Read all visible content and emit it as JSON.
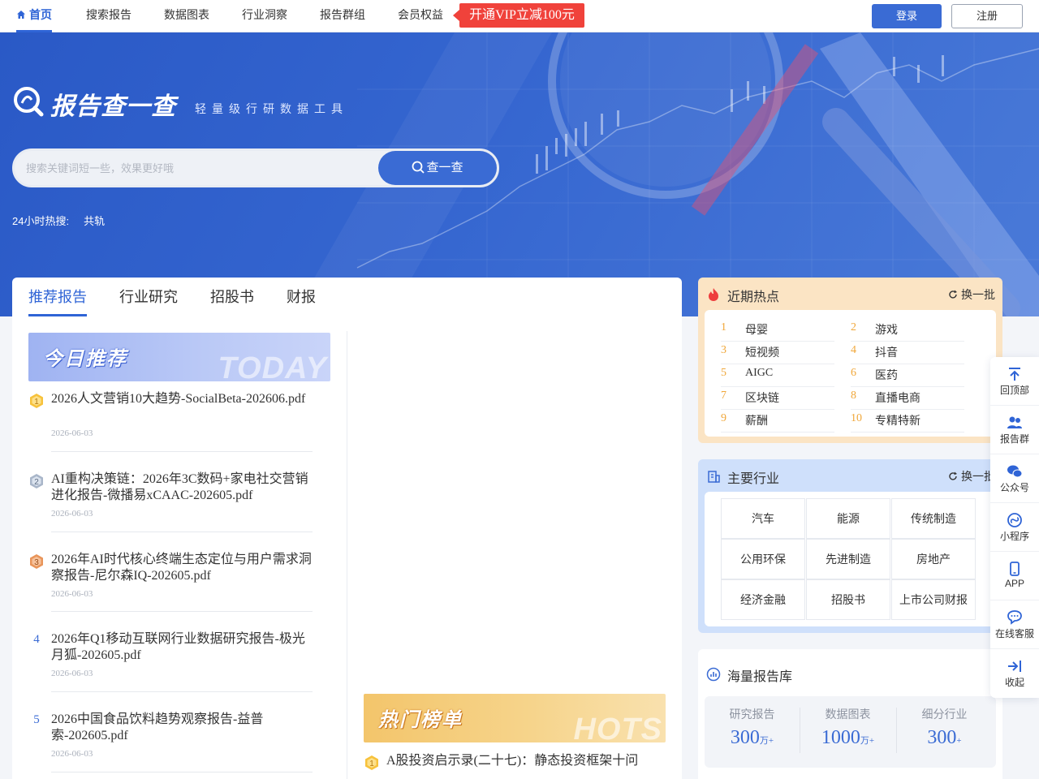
{
  "nav": {
    "items": [
      "首页",
      "搜索报告",
      "数据图表",
      "行业洞察",
      "报告群组",
      "会员权益"
    ],
    "vip_promo": "开通VIP立减100元",
    "login": "登录",
    "register": "注册"
  },
  "hero": {
    "brand": "报告查一查",
    "slogan": "轻量级行研数据工具",
    "search_placeholder": "搜索关键词短一些，效果更好哦",
    "search_button": "查一查",
    "hot_label": "24小时热搜:",
    "hot_keyword": "共轨"
  },
  "tabs": [
    "推荐报告",
    "行业研究",
    "招股书",
    "财报"
  ],
  "today": {
    "banner_title": "今日推荐",
    "banner_en": "TODAY",
    "reports": [
      {
        "rank": "1",
        "title": "2026人文营销10大趋势-SocialBeta-202606.pdf",
        "date": "2026-06-03"
      },
      {
        "rank": "2",
        "title": "AI重构决策链：2026年3C数码+家电社交营销进化报告-微播易xCAAC-202605.pdf",
        "date": "2026-06-03"
      },
      {
        "rank": "3",
        "title": "2026年AI时代核心终端生态定位与用户需求洞察报告-尼尔森IQ-202605.pdf",
        "date": "2026-06-03"
      },
      {
        "rank": "4",
        "title": "2026年Q1移动互联网行业数据研究报告-极光月狐-202605.pdf",
        "date": "2026-06-03"
      },
      {
        "rank": "5",
        "title": "2026中国食品饮料趋势观察报告-益普索-202605.pdf",
        "date": "2026-06-03"
      }
    ]
  },
  "hots": {
    "banner_title": "热门榜单",
    "banner_en": "HOTS",
    "first": {
      "rank": "1",
      "title": "A股投资启示录(二十七)：静态投资框架十问"
    }
  },
  "recent_hot": {
    "title": "近期热点",
    "refresh": "换一批",
    "items": [
      {
        "n": "1",
        "t": "母婴"
      },
      {
        "n": "2",
        "t": "游戏"
      },
      {
        "n": "3",
        "t": "短视频"
      },
      {
        "n": "4",
        "t": "抖音"
      },
      {
        "n": "5",
        "t": "AIGC"
      },
      {
        "n": "6",
        "t": "医药"
      },
      {
        "n": "7",
        "t": "区块链"
      },
      {
        "n": "8",
        "t": "直播电商"
      },
      {
        "n": "9",
        "t": "薪酬"
      },
      {
        "n": "10",
        "t": "专精特新"
      }
    ]
  },
  "industries": {
    "title": "主要行业",
    "refresh": "换一批",
    "items": [
      "汽车",
      "能源",
      "传统制造",
      "公用环保",
      "先进制造",
      "房地产",
      "经济金融",
      "招股书",
      "上市公司财报"
    ]
  },
  "library": {
    "title": "海量报告库",
    "stats": [
      {
        "label": "研究报告",
        "value": "300",
        "unit": "万+"
      },
      {
        "label": "数据图表",
        "value": "1000",
        "unit": "万+"
      },
      {
        "label": "细分行业",
        "value": "300",
        "unit": "+"
      }
    ]
  },
  "side_tools": [
    "回顶部",
    "报告群",
    "公众号",
    "小程序",
    "APP",
    "在线客服",
    "收起"
  ],
  "colors": {
    "primary": "#3a6bd4",
    "vip": "#f0423b",
    "hot_rank": "#f0a73a"
  }
}
